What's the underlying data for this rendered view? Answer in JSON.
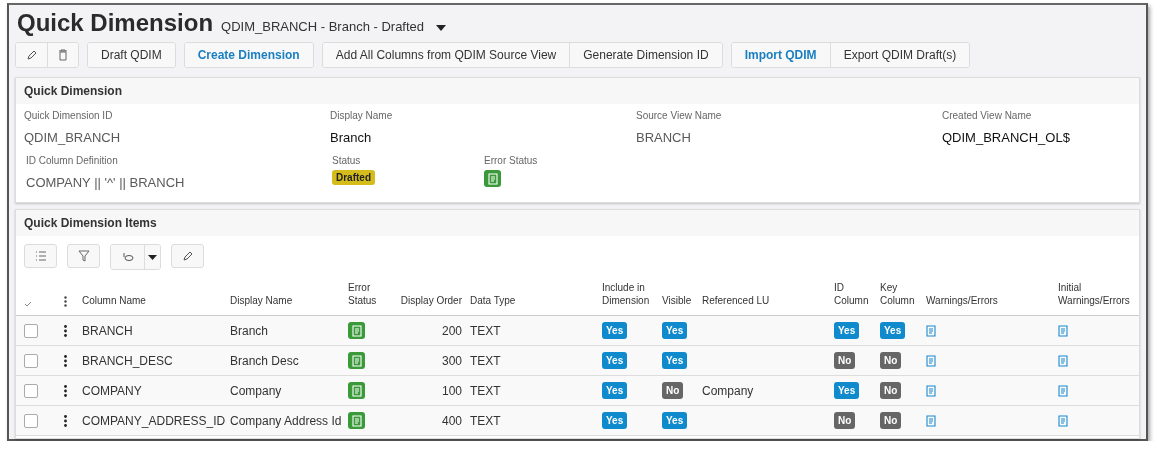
{
  "header": {
    "title": "Quick Dimension",
    "record": "QDIM_BRANCH - Branch - Drafted"
  },
  "toolbar": {
    "groups": [
      [
        {
          "label": "Draft QDIM",
          "emphasis": false
        }
      ],
      [
        {
          "label": "Create Dimension",
          "emphasis": true
        }
      ],
      [
        {
          "label": "Add All Columns from QDIM Source View",
          "emphasis": false
        },
        {
          "label": "Generate Dimension ID",
          "emphasis": false
        }
      ],
      [
        {
          "label": "Import QDIM",
          "emphasis": true
        },
        {
          "label": "Export QDIM Draft(s)",
          "emphasis": false
        }
      ]
    ]
  },
  "details": {
    "title": "Quick Dimension",
    "fields": [
      {
        "label": "Quick Dimension ID",
        "value": "QDIM_BRANCH",
        "readonly": true
      },
      {
        "label": "Display Name",
        "value": "Branch",
        "readonly": false
      },
      {
        "label": "Source View Name",
        "value": "BRANCH",
        "readonly": true
      },
      {
        "label": "Created View Name",
        "value": "QDIM_BRANCH_OL$",
        "readonly": false
      }
    ],
    "definition": {
      "label": "ID Column Definition",
      "value": "COMPANY || '^' || BRANCH"
    },
    "status": {
      "label": "Status",
      "value": "Drafted"
    },
    "error_status": {
      "label": "Error Status"
    }
  },
  "items": {
    "title": "Quick Dimension Items",
    "columns": [
      "Column Name",
      "Display Name",
      "Error Status",
      "Display Order",
      "Data Type",
      "Include in Dimension",
      "Visible",
      "Referenced LU",
      "ID Column",
      "Key Column",
      "Warnings/Errors",
      "Initial Warnings/Errors"
    ],
    "rows": [
      {
        "checked": false,
        "column_name": "BRANCH",
        "display_name": "Branch",
        "display_order": "200",
        "data_type": "TEXT",
        "include": {
          "label": "Yes",
          "on": true
        },
        "visible": {
          "label": "Yes",
          "on": true
        },
        "id_column": {
          "label": "Yes",
          "on": true
        },
        "key_column": {
          "label": "Yes",
          "on": true
        }
      },
      {
        "checked": false,
        "column_name": "BRANCH_DESC",
        "display_name": "Branch Desc",
        "display_order": "300",
        "data_type": "TEXT",
        "include": {
          "label": "Yes",
          "on": true
        },
        "visible": {
          "label": "Yes",
          "on": true
        },
        "id_column": {
          "label": "No",
          "on": false
        },
        "key_column": {
          "label": "No",
          "on": false
        }
      },
      {
        "checked": false,
        "column_name": "COMPANY",
        "display_name": "Company",
        "display_order": "100",
        "data_type": "TEXT",
        "include": {
          "label": "Yes",
          "on": true
        },
        "visible": {
          "label": "No",
          "on": false
        },
        "referenced_lu": "Company",
        "id_column": {
          "label": "Yes",
          "on": true
        },
        "key_column": {
          "label": "No",
          "on": false
        }
      },
      {
        "checked": false,
        "column_name": "COMPANY_ADDRESS_ID",
        "display_name": "Company Address Id",
        "display_order": "400",
        "data_type": "TEXT",
        "include": {
          "label": "Yes",
          "on": true
        },
        "visible": {
          "label": "Yes",
          "on": true
        },
        "id_column": {
          "label": "No",
          "on": false
        },
        "key_column": {
          "label": "No",
          "on": false
        }
      }
    ]
  }
}
